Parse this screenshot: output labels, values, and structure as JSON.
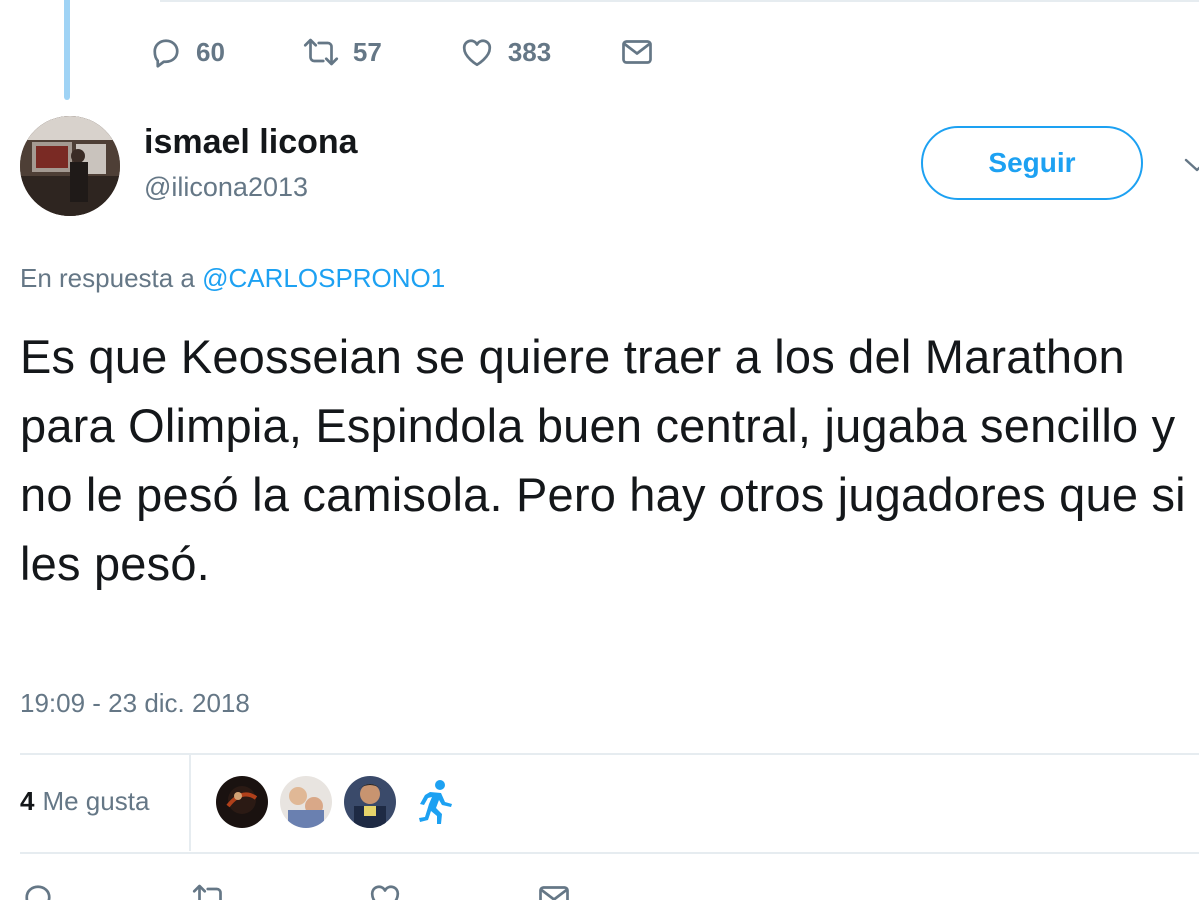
{
  "previous_tweet": {
    "actions": {
      "reply_count": "60",
      "retweet_count": "57",
      "like_count": "383"
    }
  },
  "tweet": {
    "author": {
      "display_name": "ismael licona",
      "username": "@ilicona2013"
    },
    "follow_label": "Seguir",
    "reply_prefix": "En respuesta a",
    "reply_mention": "@CARLOSPRONO1",
    "text": "Es que Keosseian se quiere traer a los del Marathon para Olimpia, Espindola buen central, jugaba sencillo y no le pesó la camisola. Pero hay otros jugadores que si les pesó.",
    "timestamp": "19:09 - 23 dic. 2018",
    "likes": {
      "count": "4",
      "label": "Me gusta"
    }
  },
  "colors": {
    "accent": "#1da1f2",
    "secondary_text": "#657786",
    "primary_text": "#14171a",
    "thread_line": "#9fd3f5",
    "divider": "#e6ecf0"
  },
  "icons": [
    "reply-icon",
    "retweet-icon",
    "like-icon",
    "message-icon",
    "chevron-down-icon",
    "runner-icon"
  ]
}
